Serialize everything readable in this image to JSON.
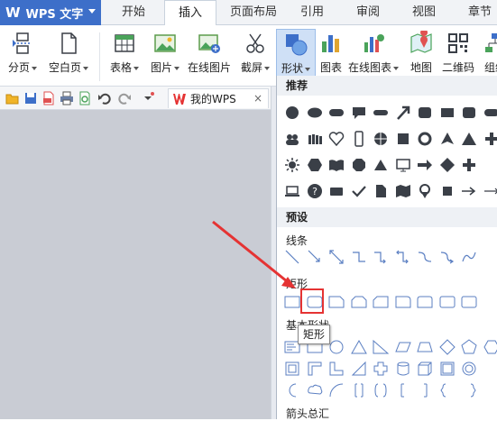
{
  "app": {
    "name": "WPS 文字",
    "logo": "W"
  },
  "tabs": [
    "开始",
    "插入",
    "页面布局",
    "引用",
    "审阅",
    "视图",
    "章节"
  ],
  "active_tab": "插入",
  "ribbon": {
    "items": [
      {
        "label": "分页",
        "icon": "page-break-icon",
        "dropdown": true
      },
      {
        "label": "空白页",
        "icon": "blank-page-icon",
        "dropdown": true
      },
      {
        "label": "表格",
        "icon": "table-icon",
        "dropdown": true
      },
      {
        "label": "图片",
        "icon": "picture-icon",
        "dropdown": true
      },
      {
        "label": "在线图片",
        "icon": "online-picture-icon",
        "dropdown": false
      },
      {
        "label": "截屏",
        "icon": "screenshot-icon",
        "dropdown": true
      },
      {
        "label": "形状",
        "icon": "shapes-icon",
        "dropdown": true
      },
      {
        "label": "图表",
        "icon": "chart-icon",
        "dropdown": false
      },
      {
        "label": "在线图表",
        "icon": "online-chart-icon",
        "dropdown": true
      },
      {
        "label": "地图",
        "icon": "map-icon",
        "dropdown": false
      },
      {
        "label": "二维码",
        "icon": "qrcode-icon",
        "dropdown": false
      },
      {
        "label": "组织",
        "icon": "org-chart-icon",
        "dropdown": false
      }
    ]
  },
  "doc_tab": {
    "title": "我的WPS",
    "close": "×"
  },
  "shapes_panel": {
    "recommended_header": "推荐",
    "preset_header": "预设",
    "sections": {
      "lines": "线条",
      "rectangles": "矩形",
      "basic_shapes": "基本形状",
      "block_arrows": "箭头总汇"
    },
    "tooltip": "矩形"
  },
  "colors": {
    "accent": "#3d6fc9",
    "highlight": "#e53333",
    "arrow": "#e53333",
    "icon_gray": "#3a3f47"
  }
}
